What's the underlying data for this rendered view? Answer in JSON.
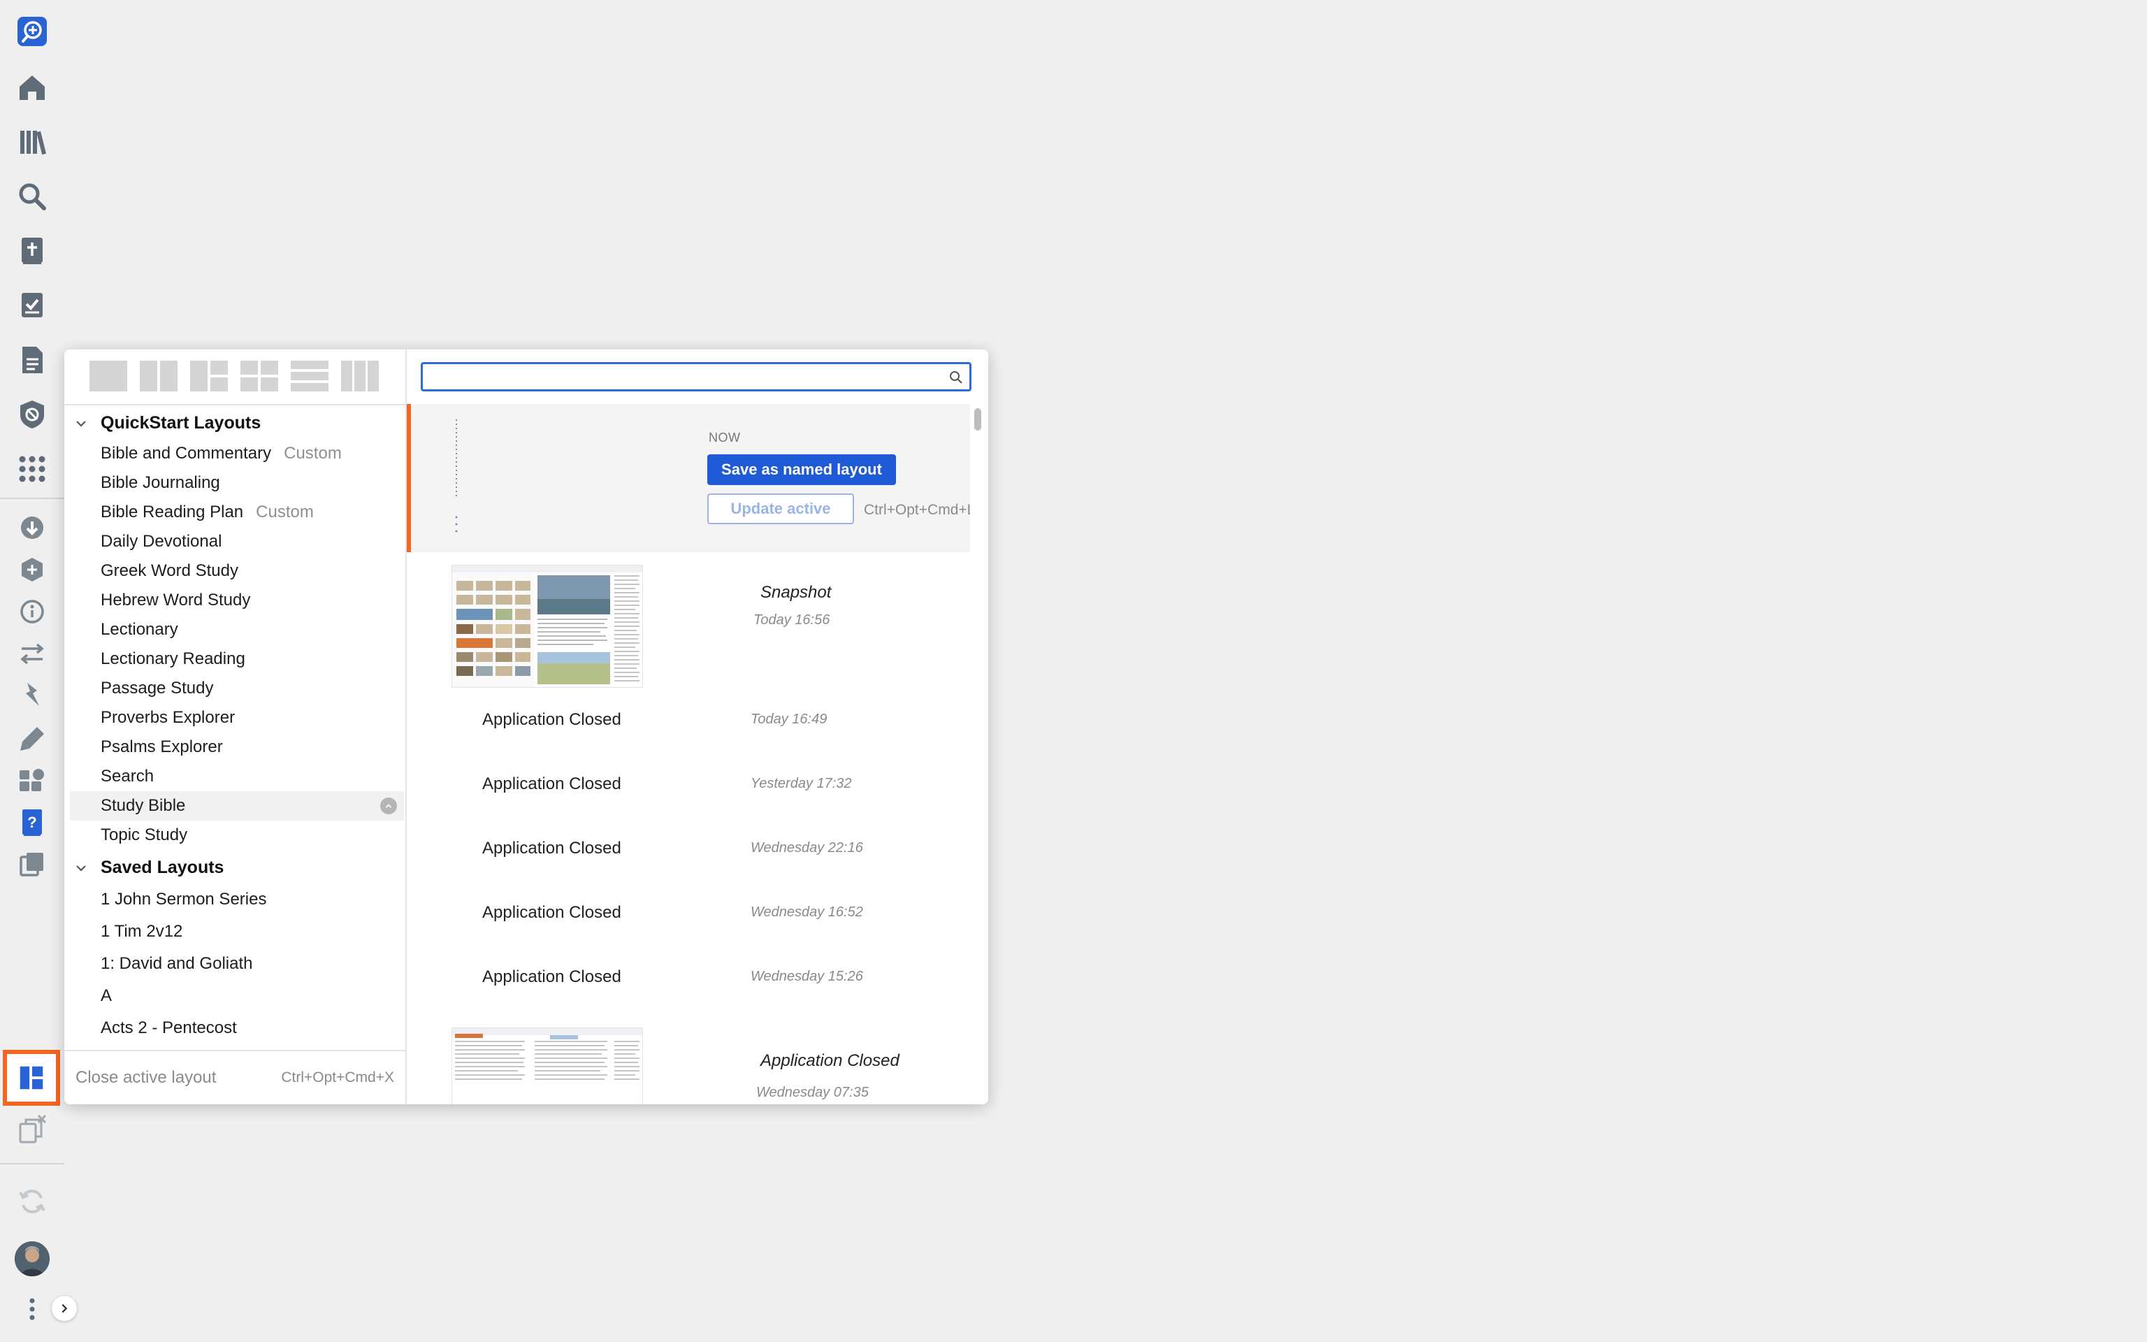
{
  "rail": {
    "items": [
      {
        "icon": "logos-search-icon"
      },
      {
        "icon": "home-icon"
      },
      {
        "icon": "library-icon"
      },
      {
        "icon": "search-icon"
      },
      {
        "icon": "bible-icon"
      },
      {
        "icon": "checklist-icon"
      },
      {
        "icon": "document-icon"
      },
      {
        "icon": "shield-icon"
      },
      {
        "icon": "apps-grid-icon"
      },
      {
        "icon": "download-icon"
      },
      {
        "icon": "add-resource-icon"
      },
      {
        "icon": "info-icon"
      },
      {
        "icon": "sync-arrows-icon"
      },
      {
        "icon": "pin-icon"
      },
      {
        "icon": "highlighter-icon"
      },
      {
        "icon": "tools-icon"
      },
      {
        "icon": "help-icon"
      },
      {
        "icon": "copy-icon"
      },
      {
        "icon": "layouts-icon"
      },
      {
        "icon": "close-layout-icon"
      },
      {
        "icon": "refresh-icon"
      }
    ],
    "colors": {
      "primary": "#2a63d4",
      "muted": "#5f6b77",
      "accent": "#f26522"
    }
  },
  "panel": {
    "templates": [
      "single-pane-icon",
      "two-pane-icon",
      "three-pane-icon",
      "four-pane-icon",
      "rows-icon",
      "three-column-icon"
    ],
    "quickstart": {
      "title": "QuickStart Layouts",
      "items": [
        {
          "label": "Bible and Commentary",
          "tag": "Custom"
        },
        {
          "label": "Bible Journaling",
          "tag": ""
        },
        {
          "label": "Bible Reading Plan",
          "tag": "Custom"
        },
        {
          "label": "Daily Devotional",
          "tag": ""
        },
        {
          "label": "Greek Word Study",
          "tag": ""
        },
        {
          "label": "Hebrew Word Study",
          "tag": ""
        },
        {
          "label": "Lectionary",
          "tag": ""
        },
        {
          "label": "Lectionary Reading",
          "tag": ""
        },
        {
          "label": "Passage Study",
          "tag": ""
        },
        {
          "label": "Proverbs Explorer",
          "tag": ""
        },
        {
          "label": "Psalms Explorer",
          "tag": ""
        },
        {
          "label": "Search",
          "tag": ""
        },
        {
          "label": "Study Bible",
          "tag": ""
        },
        {
          "label": "Topic Study",
          "tag": ""
        }
      ]
    },
    "saved": {
      "title": "Saved Layouts",
      "items": [
        "1 John Sermon Series",
        "1 Tim 2v12",
        "1: David and Goliath",
        "A",
        "Acts 2 - Pentecost"
      ]
    },
    "close_active": {
      "label": "Close active layout",
      "shortcut": "Ctrl+Opt+Cmd+X"
    },
    "search": {
      "value": "",
      "placeholder": ""
    },
    "now": {
      "label": "NOW",
      "save_button": "Save as named layout",
      "update_button": "Update active",
      "update_shortcut": "Ctrl+Opt+Cmd+L"
    },
    "history": [
      {
        "title": "Snapshot",
        "time": "Today 16:56"
      },
      {
        "title": "Application Closed",
        "time": "Today 16:49"
      },
      {
        "title": "Application Closed",
        "time": "Yesterday 17:32"
      },
      {
        "title": "Application Closed",
        "time": "Wednesday 22:16"
      },
      {
        "title": "Application Closed",
        "time": "Wednesday 16:52"
      },
      {
        "title": "Application Closed",
        "time": "Wednesday 15:26"
      },
      {
        "title": "Application Closed",
        "time": "Wednesday 07:35"
      }
    ]
  }
}
